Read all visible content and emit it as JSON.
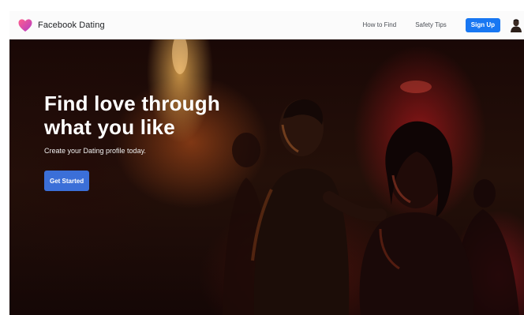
{
  "header": {
    "brand_name": "Facebook Dating",
    "brand_icon": "heart-icon",
    "nav_links": [
      {
        "label": "How to Find"
      },
      {
        "label": "Safety Tips"
      }
    ],
    "signup_label": "Sign Up",
    "avatar_icon": "profile-avatar-icon"
  },
  "hero": {
    "headline_line1": "Find love through",
    "headline_line2": "what you like",
    "subheadline": "Create your Dating profile today.",
    "cta_label": "Get Started"
  },
  "colors": {
    "brand_blue": "#1877f2",
    "cta_blue": "#3b6fd8",
    "heart_pink": "#e8457a",
    "heart_purple": "#b43cc4"
  }
}
